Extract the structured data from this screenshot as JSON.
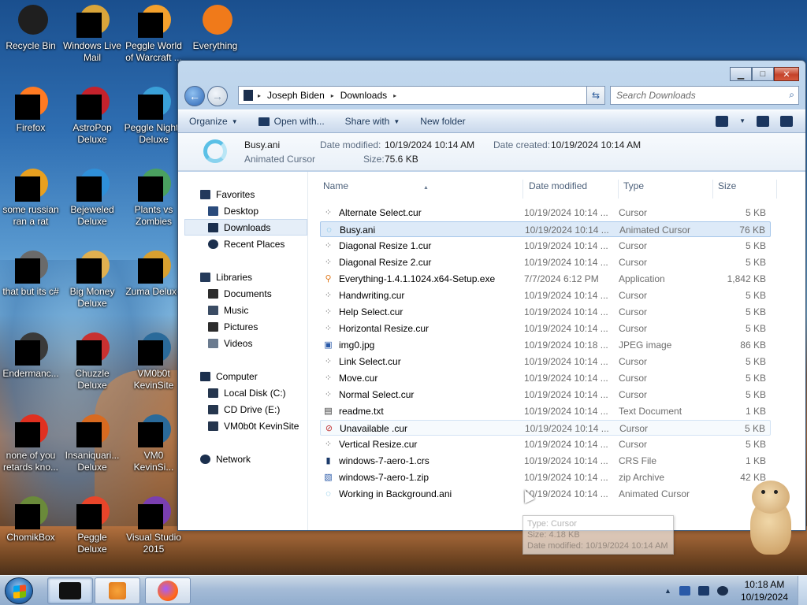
{
  "desktop_icons": [
    {
      "label": "Recycle Bin"
    },
    {
      "label": "Windows Live Mail"
    },
    {
      "label": "Peggle World of Warcraft ..."
    },
    {
      "label": "Everything"
    },
    {
      "label": "Firefox"
    },
    {
      "label": "AstroPop Deluxe"
    },
    {
      "label": "Peggle Nights Deluxe"
    },
    {
      "label": "some russian ran a rat"
    },
    {
      "label": "Bejeweled Deluxe"
    },
    {
      "label": "Plants vs Zombies"
    },
    {
      "label": "that but its c#"
    },
    {
      "label": "Big Money Deluxe"
    },
    {
      "label": "Zuma Deluxe"
    },
    {
      "label": "Endermanc..."
    },
    {
      "label": "Chuzzle Deluxe"
    },
    {
      "label": "VM0b0t KevinSite"
    },
    {
      "label": "none of you retards kno..."
    },
    {
      "label": "Insaniquari... Deluxe"
    },
    {
      "label": "VM0 KevinSi..."
    },
    {
      "label": "ChomikBox"
    },
    {
      "label": "Peggle Deluxe"
    },
    {
      "label": "Visual Studio 2015"
    }
  ],
  "window": {
    "address": {
      "segments": [
        "Joseph Biden",
        "Downloads"
      ]
    },
    "search_placeholder": "Search Downloads",
    "toolbar": {
      "organize": "Organize",
      "open_with": "Open with...",
      "share_with": "Share with",
      "new_folder": "New folder"
    },
    "details": {
      "name": "Busy.ani",
      "type": "Animated Cursor",
      "date_modified_label": "Date modified:",
      "date_modified": "10/19/2024 10:14 AM",
      "date_created_label": "Date created:",
      "date_created": "10/19/2024 10:14 AM",
      "size_label": "Size:",
      "size": "75.6 KB"
    },
    "nav": {
      "favorites": "Favorites",
      "desktop": "Desktop",
      "downloads": "Downloads",
      "recent": "Recent Places",
      "libraries": "Libraries",
      "documents": "Documents",
      "music": "Music",
      "pictures": "Pictures",
      "videos": "Videos",
      "computer": "Computer",
      "local_disk": "Local Disk (C:)",
      "cd_drive": "CD Drive (E:)",
      "vm_share": "VM0b0t KevinSite",
      "network": "Network"
    },
    "columns": {
      "name": "Name",
      "date": "Date modified",
      "type": "Type",
      "size": "Size"
    },
    "files": [
      {
        "name": "Alternate Select.cur",
        "date": "10/19/2024 10:14 ...",
        "type": "Cursor",
        "size": "5 KB",
        "icon": "cursor-icon"
      },
      {
        "name": "Busy.ani",
        "date": "10/19/2024 10:14 ...",
        "type": "Animated Cursor",
        "size": "76 KB",
        "icon": "busy-cursor-icon"
      },
      {
        "name": "Diagonal Resize 1.cur",
        "date": "10/19/2024 10:14 ...",
        "type": "Cursor",
        "size": "5 KB",
        "icon": "cursor-icon"
      },
      {
        "name": "Diagonal Resize 2.cur",
        "date": "10/19/2024 10:14 ...",
        "type": "Cursor",
        "size": "5 KB",
        "icon": "cursor-icon"
      },
      {
        "name": "Everything-1.4.1.1024.x64-Setup.exe",
        "date": "7/7/2024 6:12 PM",
        "type": "Application",
        "size": "1,842 KB",
        "icon": "everything-icon"
      },
      {
        "name": "Handwriting.cur",
        "date": "10/19/2024 10:14 ...",
        "type": "Cursor",
        "size": "5 KB",
        "icon": "cursor-icon"
      },
      {
        "name": "Help Select.cur",
        "date": "10/19/2024 10:14 ...",
        "type": "Cursor",
        "size": "5 KB",
        "icon": "cursor-icon"
      },
      {
        "name": "Horizontal Resize.cur",
        "date": "10/19/2024 10:14 ...",
        "type": "Cursor",
        "size": "5 KB",
        "icon": "cursor-icon"
      },
      {
        "name": "img0.jpg",
        "date": "10/19/2024 10:18 ...",
        "type": "JPEG image",
        "size": "86 KB",
        "icon": "image-icon"
      },
      {
        "name": "Link Select.cur",
        "date": "10/19/2024 10:14 ...",
        "type": "Cursor",
        "size": "5 KB",
        "icon": "cursor-icon"
      },
      {
        "name": "Move.cur",
        "date": "10/19/2024 10:14 ...",
        "type": "Cursor",
        "size": "5 KB",
        "icon": "cursor-icon"
      },
      {
        "name": "Normal Select.cur",
        "date": "10/19/2024 10:14 ...",
        "type": "Cursor",
        "size": "5 KB",
        "icon": "cursor-icon"
      },
      {
        "name": "readme.txt",
        "date": "10/19/2024 10:14 ...",
        "type": "Text Document",
        "size": "1 KB",
        "icon": "text-file-icon"
      },
      {
        "name": "Unavailable .cur",
        "date": "10/19/2024 10:14 ...",
        "type": "Cursor",
        "size": "5 KB",
        "icon": "unavailable-cursor-icon"
      },
      {
        "name": "Vertical Resize.cur",
        "date": "10/19/2024 10:14 ...",
        "type": "Cursor",
        "size": "5 KB",
        "icon": "cursor-icon"
      },
      {
        "name": "windows-7-aero-1.crs",
        "date": "10/19/2024 10:14 ...",
        "type": "CRS File",
        "size": "1 KB",
        "icon": "file-icon"
      },
      {
        "name": "windows-7-aero-1.zip",
        "date": "10/19/2024 10:14 ...",
        "type": "zip Archive",
        "size": "42 KB",
        "icon": "zip-icon"
      },
      {
        "name": "Working in Background.ani",
        "date": "10/19/2024 10:14 ...",
        "type": "Animated Cursor",
        "size": "",
        "icon": "busy-cursor-icon"
      }
    ],
    "selected_row": 1,
    "hover_row": 13,
    "tooltip": {
      "line1": "Type: Cursor",
      "line2": "Size: 4.18 KB",
      "line3": "Date modified: 10/19/2024 10:14 AM"
    }
  },
  "taskbar": {
    "clock_time": "10:18 AM",
    "clock_date": "10/19/2024"
  },
  "colors": {
    "selection": "#ddeaf8",
    "toolbar_text": "#1e395b",
    "muted_text": "#6d6d6d"
  }
}
